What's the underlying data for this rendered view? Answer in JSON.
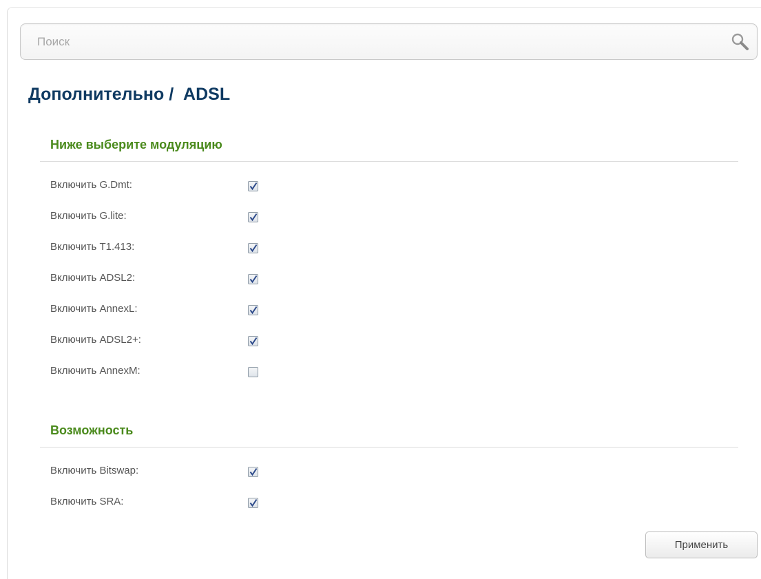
{
  "search": {
    "placeholder": "Поиск",
    "icon": "search-icon"
  },
  "page": {
    "title": "Дополнительно /  ADSL"
  },
  "modulation": {
    "title": "Ниже выберите модуляцию",
    "items": [
      {
        "label": "Включить G.Dmt:",
        "checked": true
      },
      {
        "label": "Включить G.lite:",
        "checked": true
      },
      {
        "label": "Включить T1.413:",
        "checked": true
      },
      {
        "label": "Включить ADSL2:",
        "checked": true
      },
      {
        "label": "Включить AnnexL:",
        "checked": true
      },
      {
        "label": "Включить ADSL2+:",
        "checked": true
      },
      {
        "label": "Включить AnnexM:",
        "checked": false
      }
    ]
  },
  "capability": {
    "title": "Возможность",
    "items": [
      {
        "label": "Включить Bitswap:",
        "checked": true
      },
      {
        "label": "Включить SRA:",
        "checked": true
      }
    ]
  },
  "actions": {
    "apply_label": "Применить"
  },
  "colors": {
    "title": "#0f3a62",
    "section_title": "#4a8a1c",
    "check_mark": "#2d4a8a"
  }
}
